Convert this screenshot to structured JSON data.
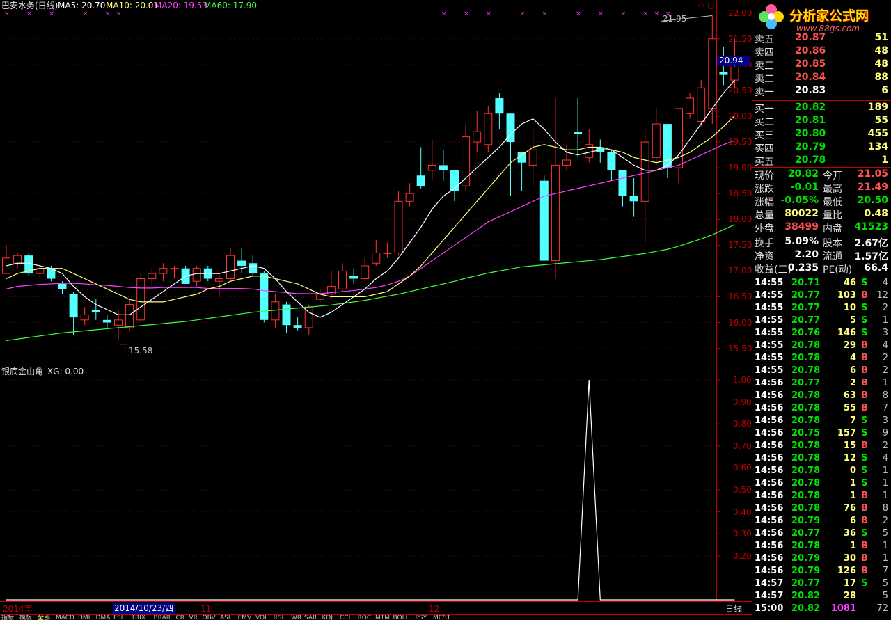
{
  "colors": {
    "up": "#ff3232",
    "down": "#54ffff",
    "ma5": "#ffffff",
    "ma10": "#ffff80",
    "ma20": "#ff40ff",
    "ma60": "#40ff40",
    "axis": "#c00000",
    "neutral": "#ffffff",
    "bright_up": "#ff5050",
    "green": "#00e000"
  },
  "header": {
    "title": "巴安水务(日线)",
    "ma5_label": "MA5: 20.70",
    "ma10_label": "MA10: 20.01",
    "ma20_label": "MA20: 19.53",
    "ma60_label": "MA60: 17.90"
  },
  "price_axis": {
    "ticks": [
      "22.00",
      "21.50",
      "21.00",
      "20.50",
      "20.00",
      "19.50",
      "19.00",
      "18.50",
      "18.00",
      "17.50",
      "17.00",
      "16.50",
      "16.00",
      "15.50"
    ],
    "current_marker": "20.94"
  },
  "annotations": {
    "high": "21.95",
    "low": "15.58"
  },
  "indicator": {
    "title": "银底金山角",
    "xg": "XG: 0.00",
    "ticks": [
      "1.00",
      "0.90",
      "0.80",
      "0.70",
      "0.60",
      "0.50",
      "0.40",
      "0.30",
      "0.20"
    ]
  },
  "date_bar": {
    "year": "2014年",
    "cursor_date": "2014/10/23/四",
    "m11": "11",
    "m12": "12",
    "period": "日线"
  },
  "bottom_tabs": [
    "指标",
    "模板",
    "全部",
    "MACD",
    "DMI",
    "DMA",
    "FSL",
    "TRIX",
    "BRAR",
    "CR",
    "VR",
    "OBV",
    "ASI",
    "EMV",
    "VOL",
    "RSI",
    "WR",
    "SAR",
    "KDJ",
    "CCI",
    "ROC",
    "MTM",
    "BOLL",
    "PSY",
    "MCST"
  ],
  "logo": {
    "title": "分析家公式网",
    "url": "www.88gs.com"
  },
  "order_book": {
    "sells": [
      {
        "label": "卖五",
        "price": "20.87",
        "vol": "51"
      },
      {
        "label": "卖四",
        "price": "20.86",
        "vol": "48"
      },
      {
        "label": "卖三",
        "price": "20.85",
        "vol": "48"
      },
      {
        "label": "卖二",
        "price": "20.84",
        "vol": "88"
      },
      {
        "label": "卖一",
        "price": "20.83",
        "vol": "6"
      }
    ],
    "buys": [
      {
        "label": "买一",
        "price": "20.82",
        "vol": "189"
      },
      {
        "label": "买二",
        "price": "20.81",
        "vol": "55"
      },
      {
        "label": "买三",
        "price": "20.80",
        "vol": "455"
      },
      {
        "label": "买四",
        "price": "20.79",
        "vol": "134"
      },
      {
        "label": "买五",
        "price": "20.78",
        "vol": "1"
      }
    ]
  },
  "quote": [
    {
      "l1": "现价",
      "v1": "20.82",
      "l2": "今开",
      "v2": "21.05"
    },
    {
      "l1": "涨跌",
      "v1": "-0.01",
      "l2": "最高",
      "v2": "21.49"
    },
    {
      "l1": "涨幅",
      "v1": "-0.05%",
      "l2": "最低",
      "v2": "20.50"
    },
    {
      "l1": "总量",
      "v1": "80022",
      "l2": "量比",
      "v2": "0.48"
    },
    {
      "l1": "外盘",
      "v1": "38499",
      "l2": "内盘",
      "v2": "41523"
    }
  ],
  "quote2": [
    {
      "l1": "换手",
      "v1": "5.09%",
      "l2": "股本",
      "v2": "2.67亿"
    },
    {
      "l1": "净资",
      "v1": "2.20",
      "l2": "流通",
      "v2": "1.57亿"
    },
    {
      "l1": "收益(三)",
      "v1": "0.235",
      "l2": "PE(动)",
      "v2": "66.4"
    }
  ],
  "ticks": [
    {
      "time": "14:55",
      "price": "20.71",
      "vol": "46",
      "bs": "S",
      "n": "4"
    },
    {
      "time": "14:55",
      "price": "20.77",
      "vol": "103",
      "bs": "B",
      "n": "12"
    },
    {
      "time": "14:55",
      "price": "20.77",
      "vol": "10",
      "bs": "S",
      "n": "2"
    },
    {
      "time": "14:55",
      "price": "20.77",
      "vol": "5",
      "bs": "S",
      "n": "1"
    },
    {
      "time": "14:55",
      "price": "20.76",
      "vol": "146",
      "bs": "S",
      "n": "3"
    },
    {
      "time": "14:55",
      "price": "20.78",
      "vol": "29",
      "bs": "B",
      "n": "4"
    },
    {
      "time": "14:55",
      "price": "20.78",
      "vol": "4",
      "bs": "B",
      "n": "2"
    },
    {
      "time": "14:55",
      "price": "20.78",
      "vol": "6",
      "bs": "B",
      "n": "2"
    },
    {
      "time": "14:56",
      "price": "20.77",
      "vol": "2",
      "bs": "B",
      "n": "1"
    },
    {
      "time": "14:56",
      "price": "20.78",
      "vol": "63",
      "bs": "B",
      "n": "8"
    },
    {
      "time": "14:56",
      "price": "20.78",
      "vol": "55",
      "bs": "B",
      "n": "7"
    },
    {
      "time": "14:56",
      "price": "20.78",
      "vol": "7",
      "bs": "S",
      "n": "3"
    },
    {
      "time": "14:56",
      "price": "20.75",
      "vol": "157",
      "bs": "S",
      "n": "9"
    },
    {
      "time": "14:56",
      "price": "20.78",
      "vol": "15",
      "bs": "B",
      "n": "2"
    },
    {
      "time": "14:56",
      "price": "20.78",
      "vol": "12",
      "bs": "S",
      "n": "4"
    },
    {
      "time": "14:56",
      "price": "20.78",
      "vol": "0",
      "bs": "S",
      "n": "1"
    },
    {
      "time": "14:56",
      "price": "20.78",
      "vol": "1",
      "bs": "S",
      "n": "1"
    },
    {
      "time": "14:56",
      "price": "20.78",
      "vol": "1",
      "bs": "B",
      "n": "1"
    },
    {
      "time": "14:56",
      "price": "20.78",
      "vol": "76",
      "bs": "B",
      "n": "8"
    },
    {
      "time": "14:56",
      "price": "20.79",
      "vol": "6",
      "bs": "B",
      "n": "2"
    },
    {
      "time": "14:56",
      "price": "20.77",
      "vol": "36",
      "bs": "S",
      "n": "5"
    },
    {
      "time": "14:56",
      "price": "20.78",
      "vol": "1",
      "bs": "B",
      "n": "1"
    },
    {
      "time": "14:56",
      "price": "20.79",
      "vol": "30",
      "bs": "B",
      "n": "1"
    },
    {
      "time": "14:56",
      "price": "20.79",
      "vol": "126",
      "bs": "B",
      "n": "7"
    },
    {
      "time": "14:57",
      "price": "20.77",
      "vol": "17",
      "bs": "S",
      "n": "5"
    },
    {
      "time": "14:57",
      "price": "20.82",
      "vol": "28",
      "bs": "",
      "n": "5"
    },
    {
      "time": "15:00",
      "price": "20.82",
      "vol": "1081",
      "bs": "",
      "n": "72"
    }
  ],
  "chart_data": {
    "type": "candlestick",
    "candles": [
      [
        16.95,
        17.25,
        17.5,
        16.95
      ],
      [
        17.15,
        17.3,
        17.35,
        17.05
      ],
      [
        17.3,
        16.95,
        17.35,
        16.9
      ],
      [
        16.95,
        17.05,
        17.1,
        16.85
      ],
      [
        17.05,
        16.85,
        17.1,
        16.8
      ],
      [
        16.75,
        16.65,
        16.8,
        16.55
      ],
      [
        16.55,
        16.1,
        16.6,
        15.75
      ],
      [
        16.05,
        16.15,
        16.3,
        15.95
      ],
      [
        16.25,
        16.2,
        16.45,
        16.05
      ],
      [
        16.05,
        16.0,
        16.15,
        15.9
      ],
      [
        15.95,
        16.05,
        16.25,
        15.65
      ],
      [
        15.9,
        16.35,
        16.45,
        15.85
      ],
      [
        16.05,
        16.85,
        16.95,
        16.0
      ],
      [
        16.85,
        16.95,
        17.05,
        16.7
      ],
      [
        16.95,
        17.05,
        17.15,
        16.8
      ],
      [
        17.05,
        17.05,
        17.1,
        16.85
      ],
      [
        17.05,
        16.75,
        17.1,
        16.75
      ],
      [
        16.8,
        17.05,
        17.1,
        16.7
      ],
      [
        17.05,
        16.85,
        17.1,
        16.8
      ],
      [
        16.8,
        16.85,
        16.95,
        16.5
      ],
      [
        16.85,
        17.3,
        17.45,
        16.8
      ],
      [
        17.2,
        17.1,
        17.45,
        16.95
      ],
      [
        17.15,
        16.95,
        17.3,
        16.9
      ],
      [
        16.95,
        16.05,
        17.0,
        16.0
      ],
      [
        16.05,
        16.4,
        16.55,
        15.9
      ],
      [
        16.35,
        15.95,
        16.4,
        15.8
      ],
      [
        15.95,
        15.9,
        16.1,
        15.85
      ],
      [
        15.9,
        16.3,
        16.35,
        15.75
      ],
      [
        16.45,
        16.55,
        16.65,
        16.4
      ],
      [
        16.55,
        16.7,
        17.0,
        16.45
      ],
      [
        16.65,
        17.0,
        17.15,
        16.6
      ],
      [
        16.9,
        16.85,
        17.05,
        16.75
      ],
      [
        16.85,
        17.1,
        17.25,
        16.8
      ],
      [
        17.15,
        17.35,
        17.6,
        17.1
      ],
      [
        17.35,
        17.35,
        17.55,
        17.25
      ],
      [
        17.35,
        18.35,
        18.55,
        17.3
      ],
      [
        18.35,
        18.5,
        18.7,
        18.25
      ],
      [
        18.85,
        18.65,
        19.4,
        18.6
      ],
      [
        18.95,
        19.05,
        19.55,
        18.75
      ],
      [
        19.05,
        18.95,
        19.35,
        18.75
      ],
      [
        18.95,
        18.55,
        18.95,
        18.35
      ],
      [
        18.65,
        19.6,
        19.85,
        18.55
      ],
      [
        19.5,
        19.7,
        20.1,
        19.3
      ],
      [
        19.45,
        20.05,
        20.2,
        19.3
      ],
      [
        20.35,
        20.05,
        20.45,
        19.75
      ],
      [
        20.05,
        19.5,
        20.05,
        18.45
      ],
      [
        19.3,
        19.1,
        19.3,
        18.55
      ],
      [
        19.05,
        19.35,
        19.75,
        18.65
      ],
      [
        18.75,
        17.2,
        18.85,
        17.2
      ],
      [
        17.2,
        19.05,
        20.35,
        16.85
      ],
      [
        19.05,
        19.15,
        19.45,
        18.95
      ],
      [
        19.7,
        19.65,
        20.35,
        19.2
      ],
      [
        19.2,
        19.45,
        19.75,
        19.1
      ],
      [
        19.4,
        19.3,
        19.55,
        19.1
      ],
      [
        19.3,
        18.95,
        19.35,
        18.75
      ],
      [
        18.95,
        18.45,
        18.95,
        18.25
      ],
      [
        18.45,
        18.35,
        18.8,
        18.05
      ],
      [
        18.35,
        19.5,
        19.75,
        17.55
      ],
      [
        19.2,
        19.85,
        20.15,
        19.05
      ],
      [
        19.85,
        19.0,
        19.85,
        18.8
      ],
      [
        19.0,
        20.15,
        20.15,
        18.7
      ],
      [
        20.05,
        20.35,
        20.45,
        19.95
      ],
      [
        19.9,
        20.55,
        20.7,
        19.8
      ],
      [
        20.15,
        21.5,
        21.95,
        19.85
      ],
      [
        20.85,
        20.8,
        21.35,
        20.6
      ],
      [
        20.7,
        20.95,
        21.5,
        20.55
      ]
    ],
    "ma5": [
      17.1,
      17.15,
      17.15,
      17.1,
      17.05,
      16.95,
      16.7,
      16.5,
      16.35,
      16.25,
      16.15,
      16.15,
      16.3,
      16.45,
      16.6,
      16.75,
      16.9,
      16.95,
      16.95,
      16.95,
      17.0,
      17.05,
      17.1,
      17.05,
      16.85,
      16.6,
      16.4,
      16.2,
      16.1,
      16.2,
      16.35,
      16.5,
      16.65,
      16.85,
      17.0,
      17.25,
      17.55,
      17.85,
      18.2,
      18.45,
      18.6,
      18.8,
      19.0,
      19.2,
      19.4,
      19.65,
      19.85,
      19.95,
      19.75,
      19.5,
      19.3,
      19.25,
      19.3,
      19.35,
      19.35,
      19.2,
      19.05,
      18.95,
      18.95,
      19.05,
      19.25,
      19.55,
      19.85,
      20.15,
      20.45,
      20.7
    ],
    "ma10": [
      16.85,
      16.95,
      17.0,
      17.05,
      17.05,
      17.05,
      16.95,
      16.85,
      16.75,
      16.65,
      16.55,
      16.45,
      16.4,
      16.4,
      16.4,
      16.45,
      16.5,
      16.55,
      16.65,
      16.7,
      16.8,
      16.85,
      16.9,
      16.9,
      16.85,
      16.8,
      16.75,
      16.65,
      16.55,
      16.5,
      16.5,
      16.5,
      16.5,
      16.55,
      16.6,
      16.75,
      16.9,
      17.1,
      17.35,
      17.6,
      17.85,
      18.1,
      18.35,
      18.6,
      18.85,
      19.1,
      19.25,
      19.4,
      19.45,
      19.4,
      19.35,
      19.35,
      19.4,
      19.4,
      19.35,
      19.3,
      19.2,
      19.15,
      19.1,
      19.15,
      19.2,
      19.3,
      19.45,
      19.6,
      19.8,
      20.01
    ],
    "ma20": [
      16.65,
      16.7,
      16.72,
      16.74,
      16.75,
      16.76,
      16.76,
      16.75,
      16.73,
      16.72,
      16.7,
      16.68,
      16.67,
      16.67,
      16.68,
      16.68,
      16.68,
      16.68,
      16.66,
      16.66,
      16.66,
      16.66,
      16.65,
      16.62,
      16.6,
      16.58,
      16.56,
      16.56,
      16.56,
      16.58,
      16.6,
      16.62,
      16.65,
      16.68,
      16.73,
      16.8,
      16.9,
      17.05,
      17.2,
      17.35,
      17.5,
      17.65,
      17.8,
      17.95,
      18.05,
      18.15,
      18.25,
      18.35,
      18.45,
      18.5,
      18.55,
      18.6,
      18.65,
      18.7,
      18.75,
      18.8,
      18.85,
      18.9,
      18.95,
      19.0,
      19.05,
      19.15,
      19.25,
      19.35,
      19.45,
      19.53
    ],
    "ma60": [
      15.65,
      15.68,
      15.71,
      15.74,
      15.77,
      15.8,
      15.82,
      15.84,
      15.86,
      15.88,
      15.9,
      15.92,
      15.94,
      15.96,
      15.98,
      16.0,
      16.02,
      16.05,
      16.08,
      16.11,
      16.14,
      16.17,
      16.2,
      16.22,
      16.24,
      16.26,
      16.28,
      16.3,
      16.32,
      16.34,
      16.37,
      16.4,
      16.43,
      16.47,
      16.51,
      16.55,
      16.6,
      16.65,
      16.7,
      16.75,
      16.8,
      16.86,
      16.91,
      16.96,
      17.0,
      17.04,
      17.08,
      17.1,
      17.12,
      17.14,
      17.16,
      17.18,
      17.2,
      17.22,
      17.25,
      17.28,
      17.31,
      17.34,
      17.38,
      17.42,
      17.48,
      17.55,
      17.62,
      17.7,
      17.8,
      17.9
    ],
    "signal_markers": [
      0,
      2,
      4,
      7,
      9,
      10,
      39,
      41,
      43,
      46,
      48,
      51,
      53,
      55,
      57,
      58,
      59
    ],
    "xg": [
      0,
      0,
      0,
      0,
      0,
      0,
      0,
      0,
      0,
      0,
      0,
      0,
      0,
      0,
      0,
      0,
      0,
      0,
      0,
      0,
      0,
      0,
      0,
      0,
      0,
      0,
      0,
      0,
      0,
      0,
      0,
      0,
      0,
      0,
      0,
      0,
      0,
      0,
      0,
      0,
      0,
      0,
      0,
      0,
      0,
      0,
      0,
      0,
      0,
      0,
      0,
      0,
      1,
      0,
      0,
      0,
      0,
      0,
      0,
      0,
      0,
      0,
      0,
      0,
      0,
      0
    ],
    "ylim": [
      15.4,
      22.05
    ],
    "indicator_ylim": [
      0,
      1.0
    ]
  }
}
